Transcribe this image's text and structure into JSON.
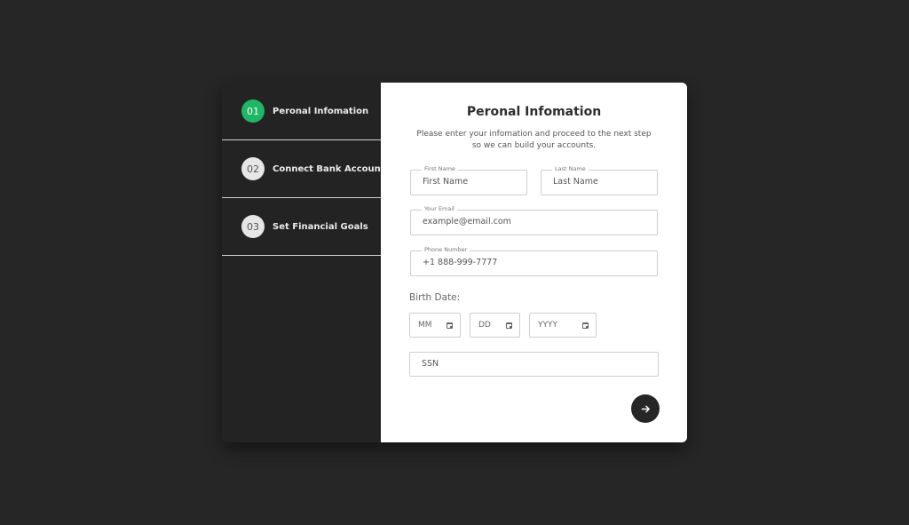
{
  "steps": [
    {
      "number": "01",
      "label": "Peronal Infomation",
      "active": true
    },
    {
      "number": "02",
      "label": "Connect Bank Account",
      "active": false
    },
    {
      "number": "03",
      "label": "Set Financial Goals",
      "active": false
    }
  ],
  "form": {
    "title": "Peronal Infomation",
    "subtitle": "Please enter your infomation and proceed to the next step so we can build your accounts.",
    "first_name": {
      "label": "First Name",
      "placeholder": "First Name"
    },
    "last_name": {
      "label": "Last Name",
      "placeholder": "Last Name"
    },
    "email": {
      "label": "Your Email",
      "placeholder": "example@email.com"
    },
    "phone": {
      "label": "Phone Number",
      "placeholder": "+1 888-999-7777"
    },
    "birth_date_label": "Birth Date:",
    "birth": {
      "month": "MM",
      "day": "DD",
      "year": "YYYY"
    },
    "ssn": {
      "placeholder": "SSN"
    }
  },
  "icons": {
    "next": "arrow-right-icon",
    "calendar": "calendar-icon"
  },
  "colors": {
    "active_step": "#1fb664",
    "sidebar_bg": "#232323",
    "page_bg": "#262626"
  }
}
